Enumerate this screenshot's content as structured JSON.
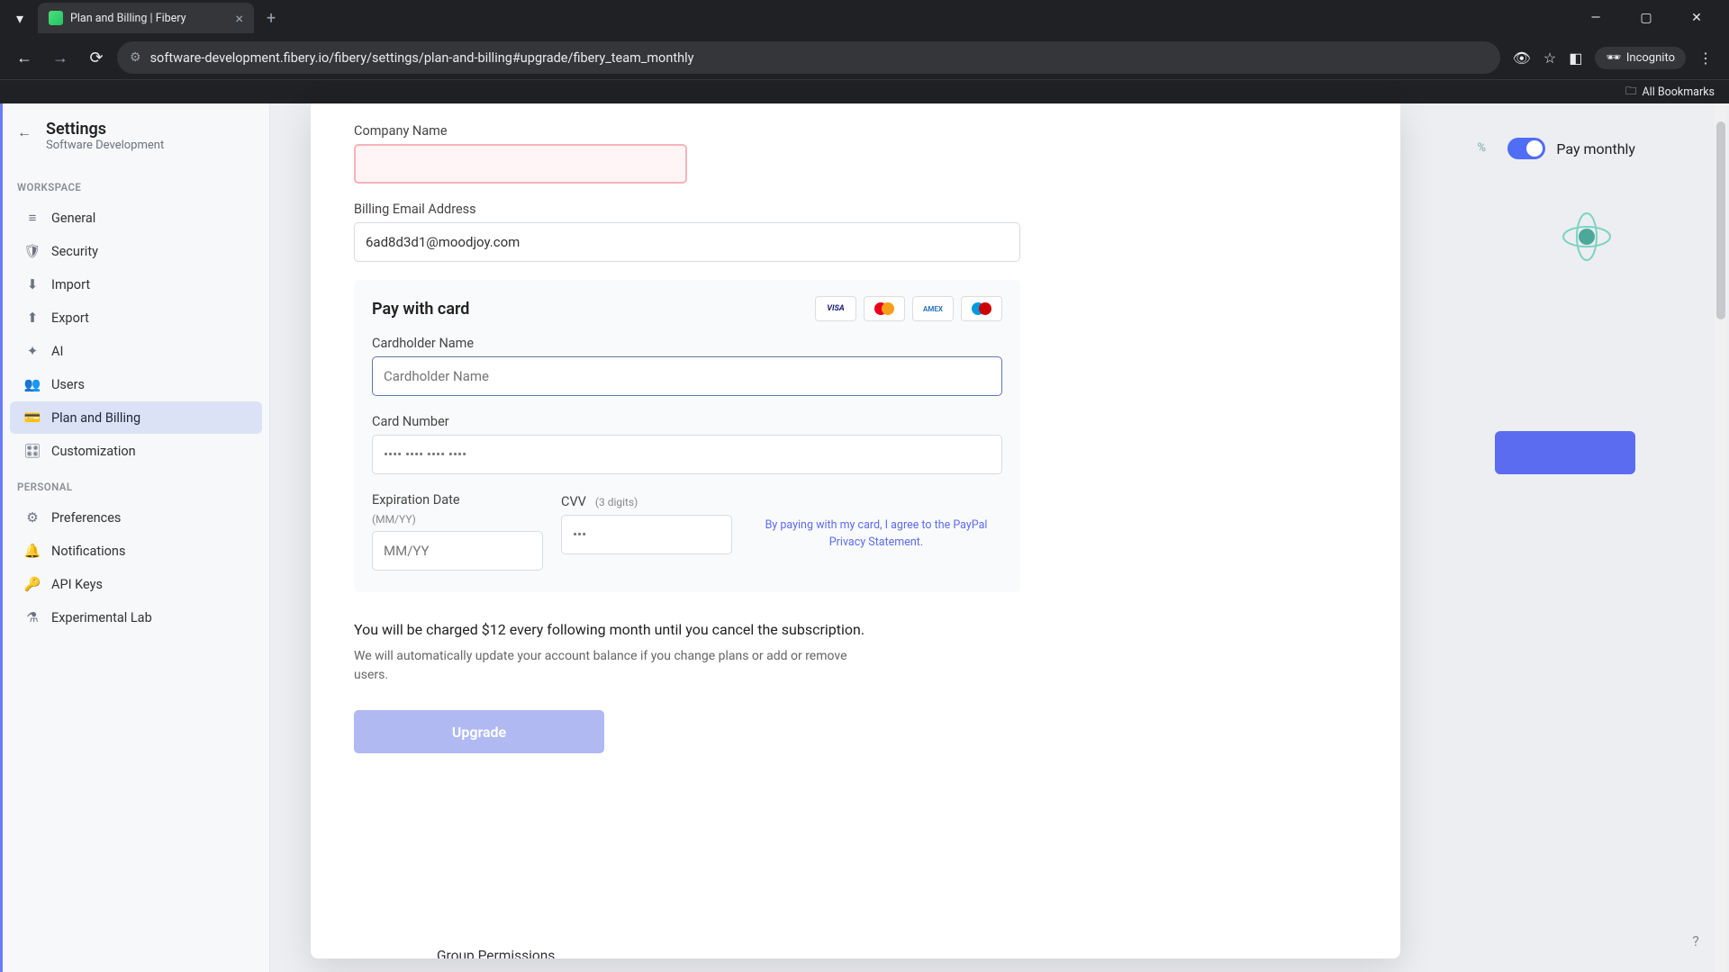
{
  "browser": {
    "tab_title": "Plan and Billing | Fibery",
    "url": "software-development.fibery.io/fibery/settings/plan-and-billing#upgrade/fibery_team_monthly",
    "incognito_label": "Incognito",
    "all_bookmarks": "All Bookmarks"
  },
  "sidebar": {
    "title": "Settings",
    "subtitle": "Software Development",
    "section_workspace": "WORKSPACE",
    "section_personal": "PERSONAL",
    "workspace_items": [
      {
        "label": "General"
      },
      {
        "label": "Security"
      },
      {
        "label": "Import"
      },
      {
        "label": "Export"
      },
      {
        "label": "AI"
      },
      {
        "label": "Users"
      },
      {
        "label": "Plan and Billing"
      },
      {
        "label": "Customization"
      }
    ],
    "personal_items": [
      {
        "label": "Preferences"
      },
      {
        "label": "Notifications"
      },
      {
        "label": "API Keys"
      },
      {
        "label": "Experimental Lab"
      }
    ]
  },
  "backdrop": {
    "pay_monthly": "Pay monthly",
    "percent_snippet": "%"
  },
  "form": {
    "company_label": "Company Name",
    "company_value": "",
    "email_label": "Billing Email Address",
    "email_value": "6ad8d3d1@moodjoy.com",
    "pay_title": "Pay with card",
    "cardholder_label": "Cardholder Name",
    "cardholder_placeholder": "Cardholder Name",
    "cardnumber_label": "Card Number",
    "cardnumber_placeholder": "•••• •••• •••• ••••",
    "exp_label": "Expiration Date",
    "exp_sub": "(MM/YY)",
    "exp_placeholder": "MM/YY",
    "cvv_label": "CVV",
    "cvv_sub": "(3 digits)",
    "cvv_placeholder": "•••",
    "agree_text": "By paying with my card, I agree to the PayPal Privacy Statement.",
    "charge_text": "You will be charged $12 every following month until you cancel the subscription.",
    "auto_text": "We will automatically update your account balance if you change plans or add or remove users.",
    "upgrade_label": "Upgrade",
    "peek_group": "Group Permissions"
  },
  "card_brands": {
    "visa": "VISA",
    "amex": "AMEX"
  }
}
